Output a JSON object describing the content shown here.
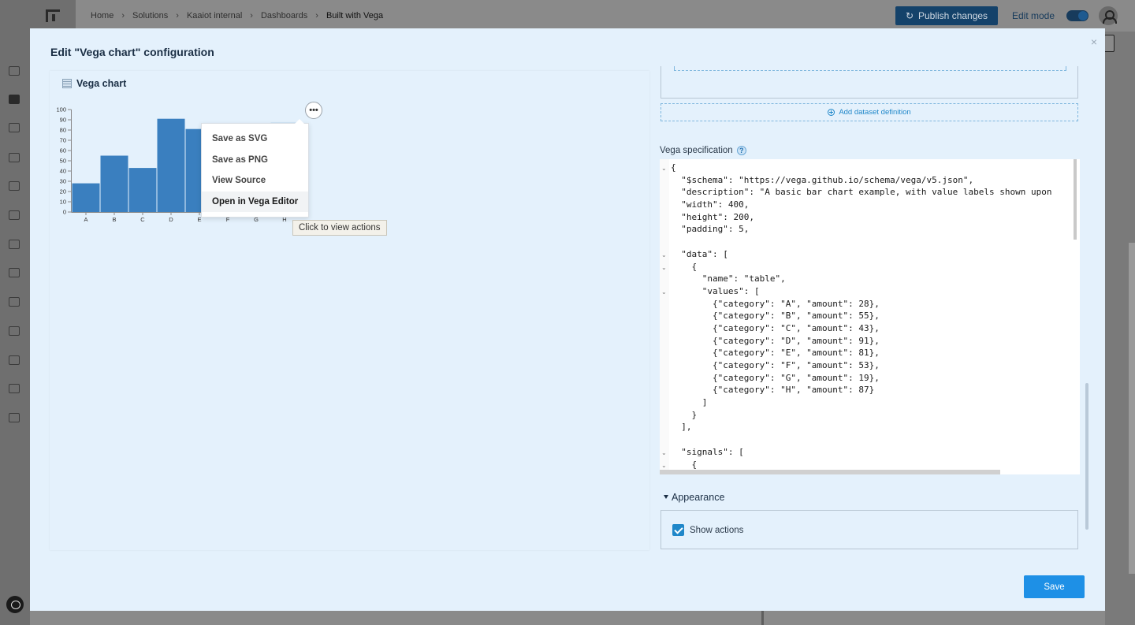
{
  "app": {
    "breadcrumb": [
      "Home",
      "Solutions",
      "Kaaiot internal",
      "Dashboards",
      "Built with Vega"
    ],
    "publish_label": "Publish changes",
    "edit_mode_label": "Edit mode",
    "edit_mode_on": true
  },
  "modal": {
    "title": "Edit \"Vega chart\" configuration",
    "close_glyph": "×",
    "save_label": "Save"
  },
  "preview": {
    "chart_title": "Vega chart",
    "actions_glyph": "•••",
    "actions_menu": [
      "Save as SVG",
      "Save as PNG",
      "View Source",
      "Open in Vega Editor"
    ],
    "hovered_item": "Open in Vega Editor",
    "tooltip": "Click to view actions"
  },
  "config": {
    "add_dataset_label": "Add dataset definition",
    "spec_label": "Vega specification",
    "help_glyph": "?",
    "code_lines": [
      "{",
      "  \"$schema\": \"https://vega.github.io/schema/vega/v5.json\",",
      "  \"description\": \"A basic bar chart example, with value labels shown upon",
      "  \"width\": 400,",
      "  \"height\": 200,",
      "  \"padding\": 5,",
      "",
      "  \"data\": [",
      "    {",
      "      \"name\": \"table\",",
      "      \"values\": [",
      "        {\"category\": \"A\", \"amount\": 28},",
      "        {\"category\": \"B\", \"amount\": 55},",
      "        {\"category\": \"C\", \"amount\": 43},",
      "        {\"category\": \"D\", \"amount\": 91},",
      "        {\"category\": \"E\", \"amount\": 81},",
      "        {\"category\": \"F\", \"amount\": 53},",
      "        {\"category\": \"G\", \"amount\": 19},",
      "        {\"category\": \"H\", \"amount\": 87}",
      "      ]",
      "    }",
      "  ],",
      "",
      "  \"signals\": [",
      "    {"
    ],
    "appearance_label": "Appearance",
    "show_actions_label": "Show actions",
    "show_actions_checked": true
  },
  "chart_data": {
    "type": "bar",
    "categories": [
      "A",
      "B",
      "C",
      "D",
      "E",
      "F",
      "G",
      "H"
    ],
    "values": [
      28,
      55,
      43,
      91,
      81,
      53,
      19,
      87
    ],
    "yticks": [
      0,
      10,
      20,
      30,
      40,
      50,
      60,
      70,
      80,
      90,
      100
    ],
    "ylim": [
      0,
      100
    ],
    "bar_color": "#3a7fbf",
    "title": "",
    "xlabel": "",
    "ylabel": ""
  },
  "colors": {
    "accent": "#1e90e6",
    "modal_bg": "#e4f1fc",
    "bar": "#3a7fbf"
  }
}
